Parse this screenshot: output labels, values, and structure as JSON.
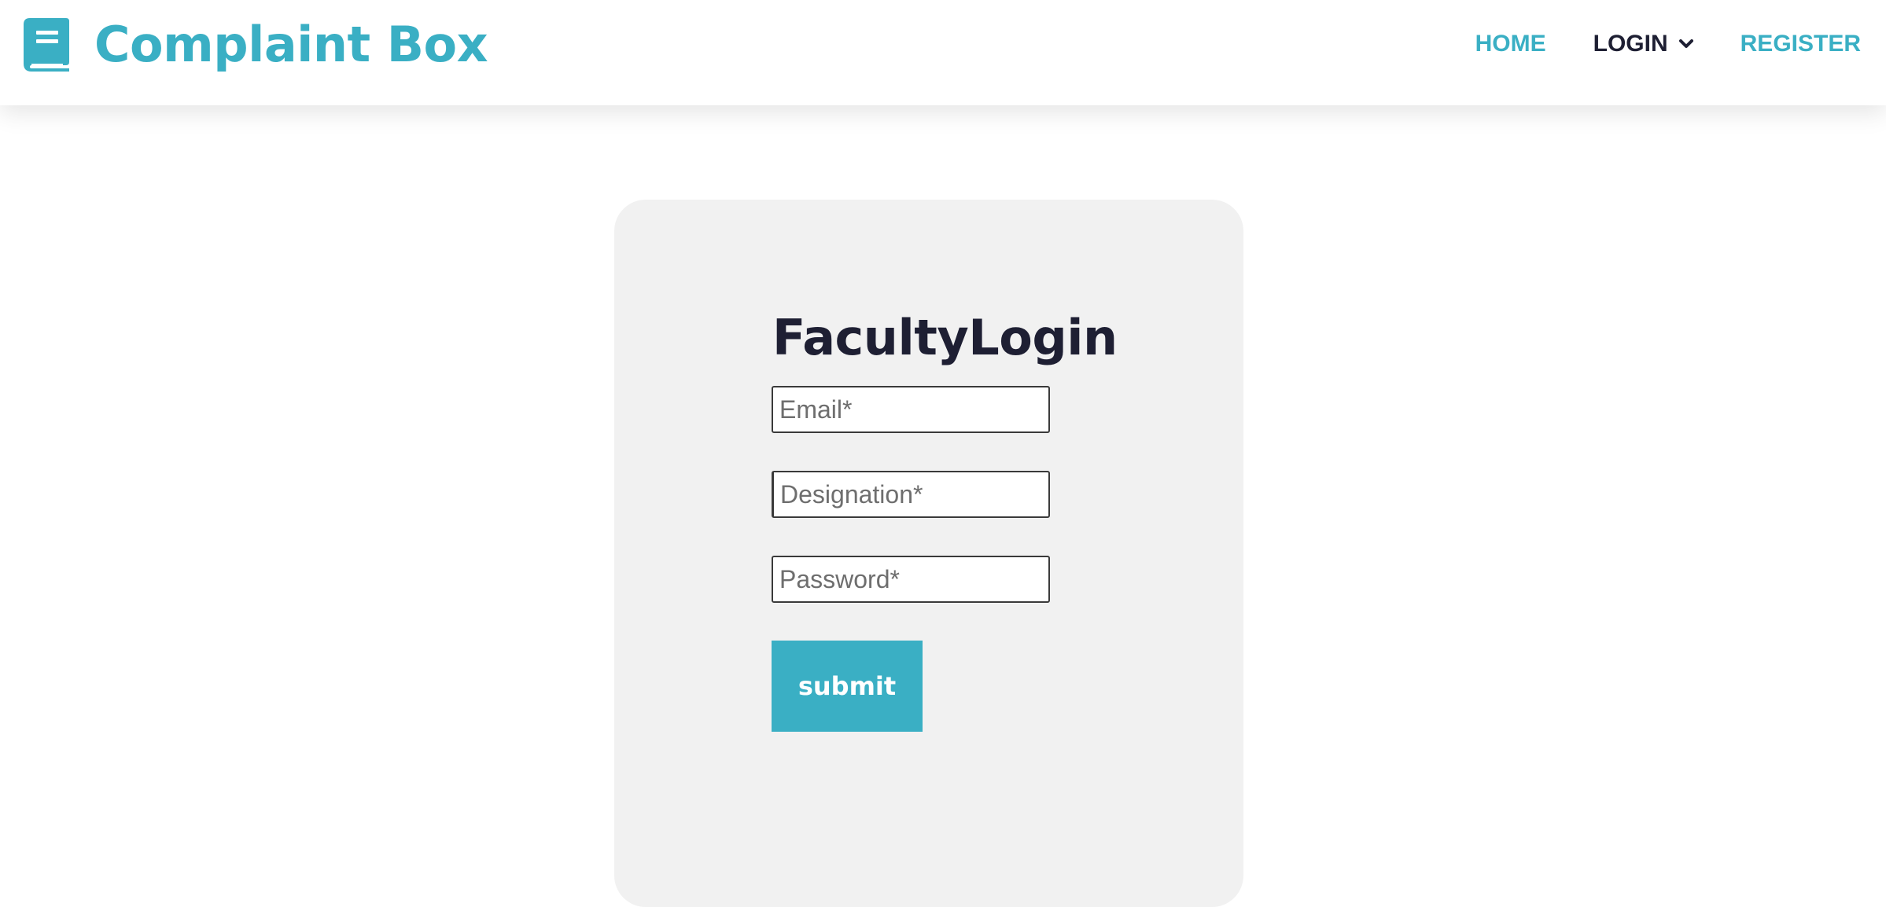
{
  "brand": {
    "icon": "book-icon",
    "name": "Complaint Box"
  },
  "nav": {
    "home": "HOME",
    "login": "LOGIN",
    "login_icon": "chevron-down-icon",
    "register": "REGISTER"
  },
  "form": {
    "title": "FacultyLogin",
    "email_placeholder": "Email*",
    "designation_placeholder": "Designation*",
    "password_placeholder": "Password*",
    "submit_label": "submit"
  },
  "colors": {
    "accent": "#3aafc4",
    "dark_text": "#1e1f33",
    "card_bg": "#f1f1f1"
  }
}
